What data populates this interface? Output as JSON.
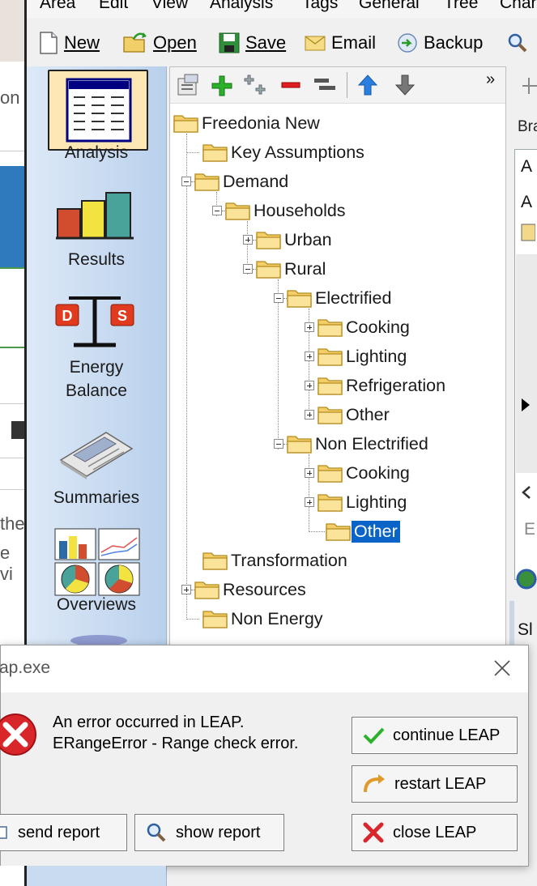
{
  "background_app": {
    "fragments": [
      "on",
      "the",
      "e vi"
    ]
  },
  "menu": [
    "Area",
    "Edit",
    "View",
    "Analysis",
    "Tags",
    "General",
    "Tree",
    "Char"
  ],
  "toolbar": {
    "new_label": "New",
    "open_label": "Open",
    "save_label": "Save",
    "email_label": "Email",
    "backup_label": "Backup"
  },
  "nav": {
    "analysis": "Analysis",
    "results": "Results",
    "energy_balance_1": "Energy",
    "energy_balance_2": "Balance",
    "summaries": "Summaries",
    "overviews": "Overviews"
  },
  "tree": {
    "overflow_glyph": "»",
    "nodes": {
      "root": "Freedonia New",
      "key_assumptions": "Key Assumptions",
      "demand": "Demand",
      "households": "Households",
      "urban": "Urban",
      "rural": "Rural",
      "electrified": "Electrified",
      "e_cooking": "Cooking",
      "e_lighting": "Lighting",
      "e_refrigeration": "Refrigeration",
      "e_other": "Other",
      "non_electrified": "Non Electrified",
      "ne_cooking": "Cooking",
      "ne_lighting": "Lighting",
      "ne_other": "Other",
      "transformation": "Transformation",
      "resources": "Resources",
      "non_energy": "Non Energy"
    }
  },
  "right_panel": {
    "bra": "Bra",
    "a1": "A",
    "a2": "A",
    "e": "E",
    "s": "Sl"
  },
  "dialog": {
    "title": "ap.exe",
    "message_line1": "An error occurred in LEAP.",
    "message_line2": "ERangeError - Range check error.",
    "continue_label": "continue LEAP",
    "restart_label": "restart LEAP",
    "close_label": "close LEAP",
    "send_report_label": "send report",
    "show_report_label": "show report"
  },
  "colors": {
    "selection": "#0a64c8",
    "error_red": "#d9262b",
    "folder_yellow": "#f6d36b",
    "nav_gradient": "#c8dbf1"
  }
}
